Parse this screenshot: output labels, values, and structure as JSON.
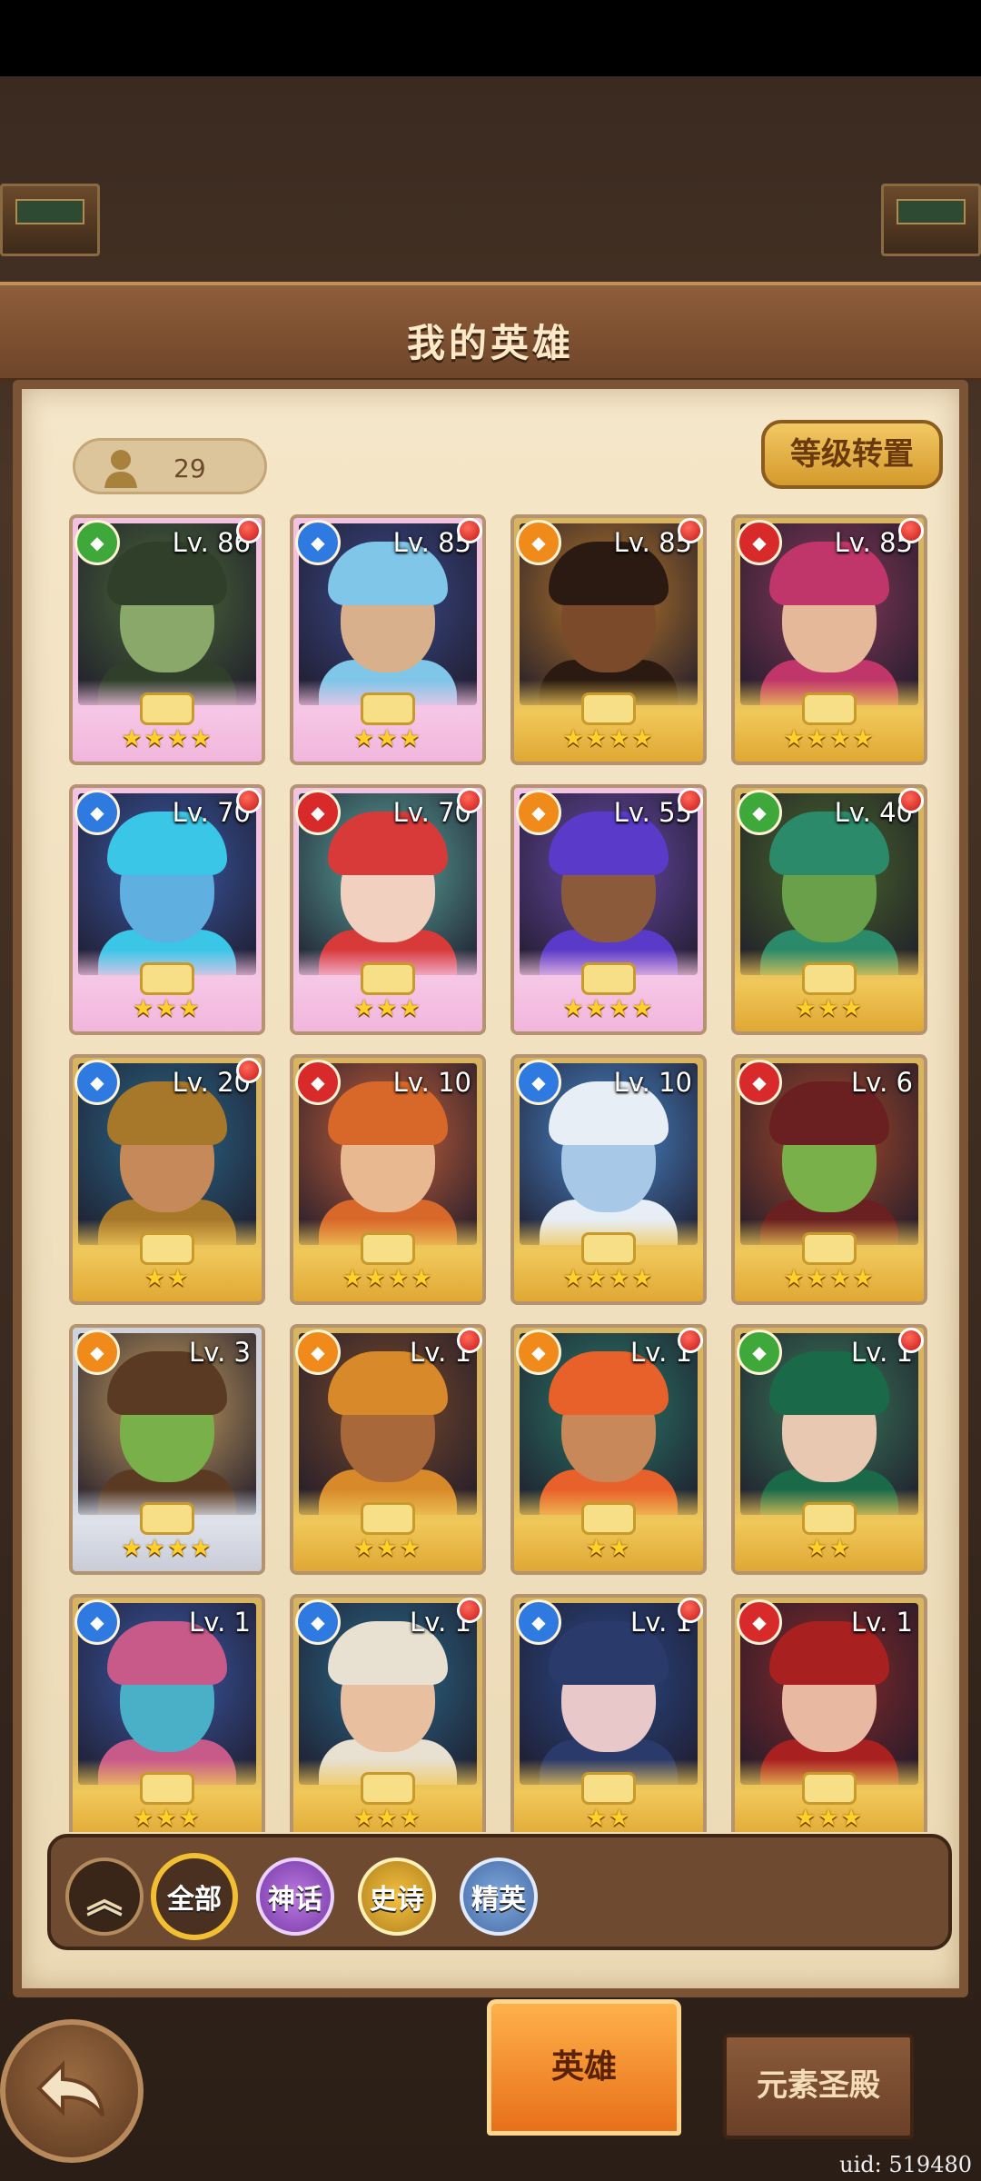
{
  "header": {
    "title": "我的英雄"
  },
  "hero_count": "29",
  "level_swap_label": "等级转置",
  "heroes": [
    {
      "level": "Lv. 86",
      "element": "green",
      "stars": "★★★★",
      "dot": true,
      "bg": "#4a6a3a",
      "skin": "#8aa86a",
      "hair": "#2f3f2a",
      "frame": "pink"
    },
    {
      "level": "Lv. 85",
      "element": "blue",
      "stars": "★★★",
      "dot": true,
      "bg": "#3a4a8a",
      "skin": "#d9b08c",
      "hair": "#7fc6e8",
      "frame": "pink"
    },
    {
      "level": "Lv. 85",
      "element": "orange",
      "stars": "★★★★",
      "dot": true,
      "bg": "#b8782a",
      "skin": "#7a4a2a",
      "hair": "#2a1a12",
      "frame": "gold"
    },
    {
      "level": "Lv. 85",
      "element": "red",
      "stars": "★★★★",
      "dot": true,
      "bg": "#8a3a5a",
      "skin": "#e6b89a",
      "hair": "#c0366a",
      "frame": "gold"
    },
    {
      "level": "Lv. 70",
      "element": "blue",
      "stars": "★★★",
      "dot": true,
      "bg": "#3a5aa8",
      "skin": "#5fb0e0",
      "hair": "#3ac6e6",
      "frame": "pink"
    },
    {
      "level": "Lv. 70",
      "element": "red",
      "stars": "★★★",
      "dot": true,
      "bg": "#5aa8a0",
      "skin": "#f2d0c0",
      "hair": "#d83a3a",
      "frame": "pink"
    },
    {
      "level": "Lv. 55",
      "element": "orange",
      "stars": "★★★★",
      "dot": true,
      "bg": "#6a4aa8",
      "skin": "#8a5a3a",
      "hair": "#5a3ac8",
      "frame": "pink"
    },
    {
      "level": "Lv. 40",
      "element": "green",
      "stars": "★★★",
      "dot": true,
      "bg": "#4a6a2a",
      "skin": "#6aa04a",
      "hair": "#2a8a6a",
      "frame": "gold"
    },
    {
      "level": "Lv. 20",
      "element": "blue",
      "stars": "★★",
      "dot": true,
      "bg": "#2a6a8a",
      "skin": "#c68a5a",
      "hair": "#a8782a",
      "frame": "gold"
    },
    {
      "level": "Lv. 10",
      "element": "red",
      "stars": "★★★★",
      "dot": false,
      "bg": "#c8623a",
      "skin": "#e8b890",
      "hair": "#d8682a",
      "frame": "gold"
    },
    {
      "level": "Lv. 10",
      "element": "blue",
      "stars": "★★★★",
      "dot": false,
      "bg": "#4a8ad0",
      "skin": "#a8c8e8",
      "hair": "#e8eef6",
      "frame": "gold"
    },
    {
      "level": "Lv. 6",
      "element": "red",
      "stars": "★★★★",
      "dot": false,
      "bg": "#a84a2a",
      "skin": "#7ab04a",
      "hair": "#6a2020",
      "frame": "gold"
    },
    {
      "level": "Lv. 3",
      "element": "orange",
      "stars": "★★★★",
      "dot": false,
      "bg": "#c8a060",
      "skin": "#7ab04a",
      "hair": "#5a3a22",
      "frame": "silver"
    },
    {
      "level": "Lv. 1",
      "element": "orange",
      "stars": "★★★",
      "dot": true,
      "bg": "#7a4a2a",
      "skin": "#a8683a",
      "hair": "#d88a2a",
      "frame": "gold"
    },
    {
      "level": "Lv. 1",
      "element": "orange",
      "stars": "★★",
      "dot": true,
      "bg": "#2a7a6a",
      "skin": "#c8885a",
      "hair": "#e8602a",
      "frame": "gold"
    },
    {
      "level": "Lv. 1",
      "element": "green",
      "stars": "★★",
      "dot": true,
      "bg": "#3a7a5a",
      "skin": "#e8c8b0",
      "hair": "#1a6a4a",
      "frame": "gold"
    },
    {
      "level": "Lv. 1",
      "element": "blue",
      "stars": "★★★",
      "dot": false,
      "bg": "#3a5aa8",
      "skin": "#4ab0c8",
      "hair": "#c85a8a",
      "frame": "gold"
    },
    {
      "level": "Lv. 1",
      "element": "blue",
      "stars": "★★★",
      "dot": true,
      "bg": "#2a6a8a",
      "skin": "#e8c0a0",
      "hair": "#e8e0d0",
      "frame": "gold"
    },
    {
      "level": "Lv. 1",
      "element": "blue",
      "stars": "★★",
      "dot": true,
      "bg": "#2a4a8a",
      "skin": "#e8c8c8",
      "hair": "#2a3a6a",
      "frame": "gold"
    },
    {
      "level": "Lv. 1",
      "element": "red",
      "stars": "★★★",
      "dot": false,
      "bg": "#8a2a2a",
      "skin": "#e8b8a0",
      "hair": "#a82020",
      "frame": "gold"
    }
  ],
  "filters": {
    "all": "全部",
    "myth": "神话",
    "epic": "史诗",
    "elite": "精英"
  },
  "tabs": {
    "hero": "英雄",
    "temple": "元素圣殿"
  },
  "uid": "uid: 519480",
  "element_colors": {
    "green": "#3fa83a",
    "blue": "#2f7ae0",
    "orange": "#f08a1a",
    "red": "#d82a2a"
  }
}
